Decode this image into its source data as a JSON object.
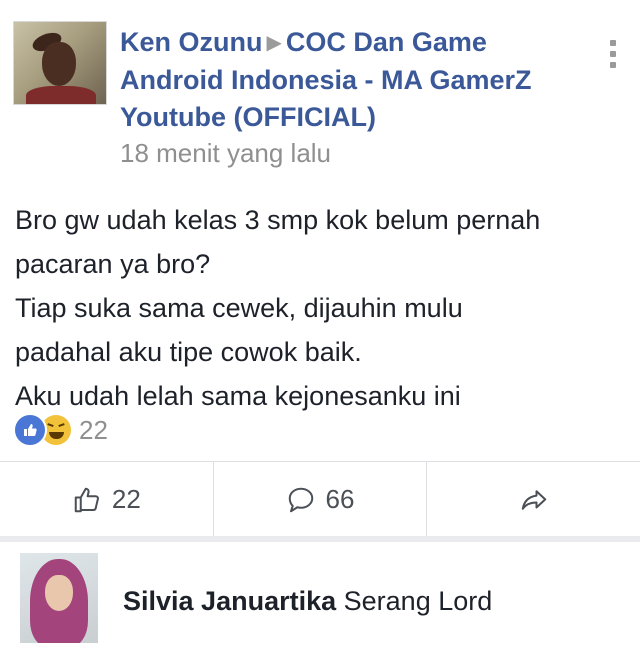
{
  "post": {
    "author": "Ken Ozunu",
    "group_line1": "COC Dan Game",
    "group_line2": "Android Indonesia - MA GamerZ",
    "group_line3": "Youtube (OFFICIAL)",
    "timestamp": "18 menit yang lalu",
    "body_lines": [
      "Bro gw udah kelas 3 smp kok belum pernah",
      "pacaran ya bro?",
      "Tiap suka sama cewek, dijauhin mulu",
      "padahal aku tipe cowok baik.",
      "Aku udah lelah sama kejonesanku ini"
    ],
    "reaction_count": "22",
    "reaction_icons": [
      "like-icon",
      "haha-icon"
    ]
  },
  "actions": {
    "like_count": "22",
    "comment_count": "66",
    "share_icon": "share-icon"
  },
  "comment": {
    "name": "Silvia Januartika",
    "text": "Serang Lord"
  },
  "colors": {
    "author_blue": "#3b5998",
    "like_blue": "#4a76d6",
    "haha_yellow": "#f2c23a"
  }
}
